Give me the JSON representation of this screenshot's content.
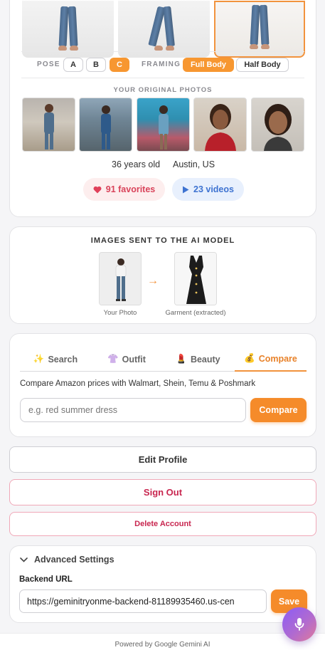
{
  "pose": {
    "label": "POSE",
    "options": [
      "A",
      "B",
      "C"
    ],
    "selected": "C"
  },
  "framing": {
    "label": "FRAMING",
    "options": [
      "Full Body",
      "Half Body"
    ],
    "selected": "Full Body"
  },
  "original_photos": {
    "label": "YOUR ORIGINAL PHOTOS",
    "count": 5
  },
  "profile": {
    "age": "36 years old",
    "location": "Austin, US"
  },
  "stats": {
    "favorites": "91 favorites",
    "videos": "23 videos"
  },
  "ai_images": {
    "title": "IMAGES SENT TO THE AI MODEL",
    "photo_caption": "Your Photo",
    "garment_caption": "Garment (extracted)",
    "arrow": "→"
  },
  "tabs": [
    {
      "icon": "✨",
      "label": "Search"
    },
    {
      "icon": "👚",
      "label": "Outfit"
    },
    {
      "icon": "💄",
      "label": "Beauty"
    },
    {
      "icon": "💰",
      "label": "Compare"
    }
  ],
  "active_tab": "Compare",
  "compare": {
    "description": "Compare Amazon prices with Walmart, Shein, Temu & Poshmark",
    "placeholder": "e.g. red summer dress",
    "button": "Compare"
  },
  "account": {
    "edit_profile": "Edit Profile",
    "sign_out": "Sign Out",
    "delete_account": "Delete Account"
  },
  "advanced": {
    "title": "Advanced Settings",
    "backend_label": "Backend URL",
    "backend_url": "https://geminitryonme-backend-81189935460.us-cen",
    "save": "Save"
  },
  "footer": "Powered by Google Gemini AI",
  "colors": {
    "accent": "#f58b2a",
    "danger": "#c8264f",
    "favorites": "#d9435a",
    "videos": "#3e73d1"
  }
}
